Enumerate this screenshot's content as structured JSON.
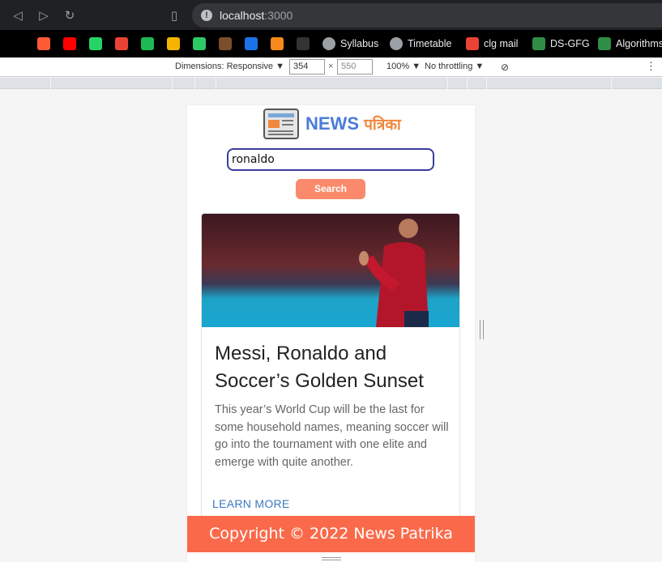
{
  "browser": {
    "url_host": "localhost",
    "url_port": ":3000",
    "bookmarks": [
      {
        "label": "",
        "icon": "notion-icon",
        "color": "#000000"
      },
      {
        "label": "",
        "icon": "invision-icon",
        "color": "#ff5a36"
      },
      {
        "label": "",
        "icon": "youtube-music-icon",
        "color": "#ff0000"
      },
      {
        "label": "",
        "icon": "whatsapp-icon",
        "color": "#25d366"
      },
      {
        "label": "",
        "icon": "gmail-icon",
        "color": "#ea4335"
      },
      {
        "label": "",
        "icon": "spotify-icon",
        "color": "#1db954"
      },
      {
        "label": "",
        "icon": "classroom-icon",
        "color": "#f4b400"
      },
      {
        "label": "",
        "icon": "hackerrank-icon",
        "color": "#2ec866"
      },
      {
        "label": "",
        "icon": "cc-icon",
        "color": "#7a4e2d"
      },
      {
        "label": "",
        "icon": "at-icon",
        "color": "#1a73e8"
      },
      {
        "label": "",
        "icon": "codingninjas-icon",
        "color": "#f78a1d"
      },
      {
        "label": "",
        "icon": "github-icon",
        "color": "#333333"
      },
      {
        "label": "Syllabus",
        "icon": "globe-icon",
        "color": "#9aa0a6"
      },
      {
        "label": "Timetable",
        "icon": "globe-icon",
        "color": "#9aa0a6"
      },
      {
        "label": "clg mail",
        "icon": "gmail-icon",
        "color": "#ea4335"
      },
      {
        "label": "DS-GFG",
        "icon": "gfg-icon",
        "color": "#2f8d46"
      },
      {
        "label": "Algorithms",
        "icon": "gfg-icon",
        "color": "#2f8d46"
      }
    ]
  },
  "devtools": {
    "dimensions_label": "Dimensions: Responsive",
    "width": "354",
    "height": "550",
    "zoom": "100%",
    "throttling": "No throttling"
  },
  "app": {
    "brand_en": "NEWS",
    "brand_hi": "पत्रिका",
    "search_value": "ronaldo",
    "search_button": "Search",
    "article": {
      "title": "Messi, Ronaldo and Soccer’s Golden Sunset",
      "description": "This year’s World Cup will be the last for some household names, meaning soccer will go into the tournament with one elite and emerge with quite another.",
      "cta": "LEARN MORE"
    },
    "footer": "Copyright © 2022 News Patrika"
  },
  "colors": {
    "accent": "#fa6a4a",
    "button": "#fa8a6b",
    "brand_blue": "#4a7bd8",
    "brand_orange": "#f0883e"
  }
}
